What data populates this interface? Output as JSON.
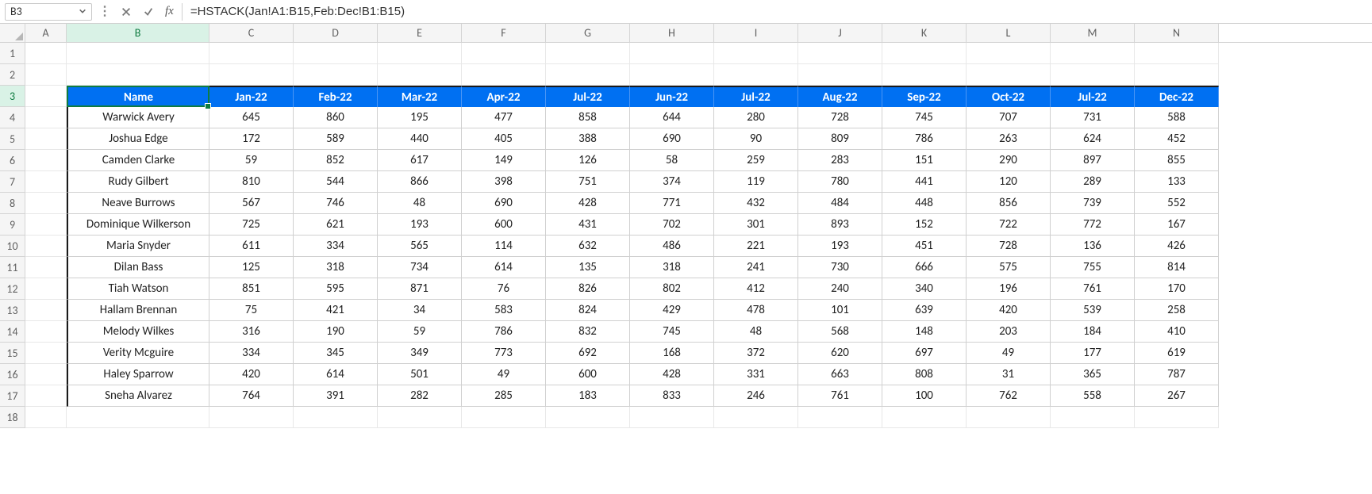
{
  "ui": {
    "name_box_value": "B3",
    "fx_label": "fx",
    "formula_value": "=HSTACK(Jan!A1:B15,Feb:Dec!B1:B15)"
  },
  "columns_letters": [
    "A",
    "B",
    "C",
    "D",
    "E",
    "F",
    "G",
    "H",
    "I",
    "J",
    "K",
    "L",
    "M",
    "N"
  ],
  "row_numbers": [
    "1",
    "2",
    "3",
    "4",
    "5",
    "6",
    "7",
    "8",
    "9",
    "10",
    "11",
    "12",
    "13",
    "14",
    "15",
    "16",
    "17",
    "18"
  ],
  "active_col_index": 1,
  "active_row_index": 2,
  "table": {
    "headers": [
      "Name",
      "Jan-22",
      "Feb-22",
      "Mar-22",
      "Apr-22",
      "Jul-22",
      "Jun-22",
      "Jul-22",
      "Aug-22",
      "Sep-22",
      "Oct-22",
      "Jul-22",
      "Dec-22"
    ],
    "rows": [
      {
        "name": "Warwick Avery",
        "v": [
          "645",
          "860",
          "195",
          "477",
          "858",
          "644",
          "280",
          "728",
          "745",
          "707",
          "731",
          "588"
        ]
      },
      {
        "name": "Joshua Edge",
        "v": [
          "172",
          "589",
          "440",
          "405",
          "388",
          "690",
          "90",
          "809",
          "786",
          "263",
          "624",
          "452"
        ]
      },
      {
        "name": "Camden Clarke",
        "v": [
          "59",
          "852",
          "617",
          "149",
          "126",
          "58",
          "259",
          "283",
          "151",
          "290",
          "897",
          "855"
        ]
      },
      {
        "name": "Rudy Gilbert",
        "v": [
          "810",
          "544",
          "866",
          "398",
          "751",
          "374",
          "119",
          "780",
          "441",
          "120",
          "289",
          "133"
        ]
      },
      {
        "name": "Neave Burrows",
        "v": [
          "567",
          "746",
          "48",
          "690",
          "428",
          "771",
          "432",
          "484",
          "448",
          "856",
          "739",
          "552"
        ]
      },
      {
        "name": "Dominique Wilkerson",
        "v": [
          "725",
          "621",
          "193",
          "600",
          "431",
          "702",
          "301",
          "893",
          "152",
          "722",
          "772",
          "167"
        ]
      },
      {
        "name": "Maria Snyder",
        "v": [
          "611",
          "334",
          "565",
          "114",
          "632",
          "486",
          "221",
          "193",
          "451",
          "728",
          "136",
          "426"
        ]
      },
      {
        "name": "Dilan Bass",
        "v": [
          "125",
          "318",
          "734",
          "614",
          "135",
          "318",
          "241",
          "730",
          "666",
          "575",
          "755",
          "814"
        ]
      },
      {
        "name": "Tiah Watson",
        "v": [
          "851",
          "595",
          "871",
          "76",
          "826",
          "802",
          "412",
          "240",
          "340",
          "196",
          "761",
          "170"
        ]
      },
      {
        "name": "Hallam Brennan",
        "v": [
          "75",
          "421",
          "34",
          "583",
          "824",
          "429",
          "478",
          "101",
          "639",
          "420",
          "539",
          "258"
        ]
      },
      {
        "name": "Melody Wilkes",
        "v": [
          "316",
          "190",
          "59",
          "786",
          "832",
          "745",
          "48",
          "568",
          "148",
          "203",
          "184",
          "410"
        ]
      },
      {
        "name": "Verity Mcguire",
        "v": [
          "334",
          "345",
          "349",
          "773",
          "692",
          "168",
          "372",
          "620",
          "697",
          "49",
          "177",
          "619"
        ]
      },
      {
        "name": "Haley Sparrow",
        "v": [
          "420",
          "614",
          "501",
          "49",
          "600",
          "428",
          "331",
          "663",
          "808",
          "31",
          "365",
          "787"
        ]
      },
      {
        "name": "Sneha Alvarez",
        "v": [
          "764",
          "391",
          "282",
          "285",
          "183",
          "833",
          "246",
          "761",
          "100",
          "762",
          "558",
          "267"
        ]
      }
    ]
  }
}
